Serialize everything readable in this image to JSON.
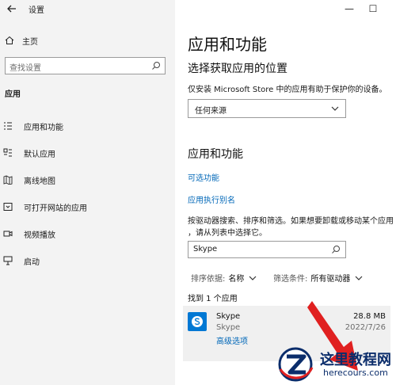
{
  "window": {
    "title": "设置",
    "minimize_glyph": "—",
    "maximize_glyph": "☐"
  },
  "sidebar": {
    "home_label": "主页",
    "search_placeholder": "查找设置",
    "section_label": "应用",
    "items": [
      {
        "label": "应用和功能",
        "icon": "apps-list-icon"
      },
      {
        "label": "默认应用",
        "icon": "default-apps-icon"
      },
      {
        "label": "离线地图",
        "icon": "offline-maps-icon"
      },
      {
        "label": "可打开网站的应用",
        "icon": "apps-for-websites-icon"
      },
      {
        "label": "视频播放",
        "icon": "video-playback-icon"
      },
      {
        "label": "启动",
        "icon": "startup-icon"
      }
    ]
  },
  "main": {
    "title": "应用和功能",
    "install_heading": "选择获取应用的位置",
    "install_desc": "仅安装 Microsoft Store 中的应用有助于保护你的设备。",
    "install_select_value": "任何来源",
    "apps_heading": "应用和功能",
    "link_optional": "可选功能",
    "link_alias": "应用执行别名",
    "search_desc_line1": "按驱动器搜索、排序和筛选。如果想要卸载或移动某个应用",
    "search_desc_line2": "，请从列表中选择它。",
    "search_value": "Skype",
    "sort_key": "排序依据:",
    "sort_value": "名称",
    "filter_key": "筛选条件:",
    "filter_value": "所有驱动器",
    "found_text": "找到 1 个应用",
    "app": {
      "name": "Skype",
      "publisher": "Skype",
      "advanced": "高级选项",
      "size": "28.8 MB",
      "date": "2022/7/26"
    }
  },
  "watermark": {
    "title": "这里教程网",
    "url": "herecours.com"
  },
  "colors": {
    "link": "#0067b8",
    "skype": "#0078d4",
    "arrow": "#e02020",
    "watermark": "#0b2d6b"
  }
}
